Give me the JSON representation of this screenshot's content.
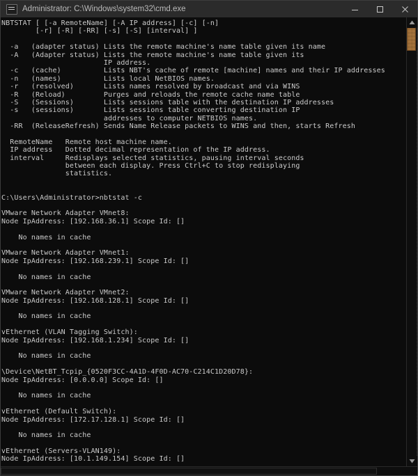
{
  "window": {
    "title": "Administrator: C:\\Windows\\system32\\cmd.exe",
    "icon": "cmd-icon",
    "minimize_label": "–",
    "maximize_label": "□",
    "close_label": "✕",
    "background_color": "#0c0c0c",
    "titlebar_color": "#2b2b2b",
    "text_color": "#cccccc",
    "scrollbar_thumb_color": "#8a5d2e"
  },
  "console": {
    "lines": [
      "NBTSTAT [ [-a RemoteName] [-A IP address] [-c] [-n]",
      "        [-r] [-R] [-RR] [-s] [-S] [interval] ]",
      "",
      "  -a   (adapter status) Lists the remote machine's name table given its name",
      "  -A   (Adapter status) Lists the remote machine's name table given its",
      "                        IP address.",
      "  -c   (cache)          Lists NBT's cache of remote [machine] names and their IP addresses",
      "  -n   (names)          Lists local NetBIOS names.",
      "  -r   (resolved)       Lists names resolved by broadcast and via WINS",
      "  -R   (Reload)         Purges and reloads the remote cache name table",
      "  -S   (Sessions)       Lists sessions table with the destination IP addresses",
      "  -s   (sessions)       Lists sessions table converting destination IP",
      "                        addresses to computer NETBIOS names.",
      "  -RR  (ReleaseRefresh) Sends Name Release packets to WINS and then, starts Refresh",
      "",
      "  RemoteName   Remote host machine name.",
      "  IP address   Dotted decimal representation of the IP address.",
      "  interval     Redisplays selected statistics, pausing interval seconds",
      "               between each display. Press Ctrl+C to stop redisplaying",
      "               statistics.",
      "",
      "",
      "C:\\Users\\Administrator>nbtstat -c",
      "",
      "VMware Network Adapter VMnet8:",
      "Node IpAddress: [192.168.36.1] Scope Id: []",
      "",
      "    No names in cache",
      "",
      "VMware Network Adapter VMnet1:",
      "Node IpAddress: [192.168.239.1] Scope Id: []",
      "",
      "    No names in cache",
      "",
      "VMware Network Adapter VMnet2:",
      "Node IpAddress: [192.168.128.1] Scope Id: []",
      "",
      "    No names in cache",
      "",
      "vEthernet (VLAN Tagging Switch):",
      "Node IpAddress: [192.168.1.234] Scope Id: []",
      "",
      "    No names in cache",
      "",
      "\\Device\\NetBT_Tcpip_{0520F3CC-4A1D-4F0D-AC70-C214C1D20D78}:",
      "Node IpAddress: [0.0.0.0] Scope Id: []",
      "",
      "    No names in cache",
      "",
      "vEthernet (Default Switch):",
      "Node IpAddress: [172.17.128.1] Scope Id: []",
      "",
      "    No names in cache",
      "",
      "vEthernet (Servers-VLAN149):",
      "Node IpAddress: [10.1.149.154] Scope Id: []"
    ],
    "prompt": "C:\\Users\\Administrator>",
    "command": "nbtstat -c"
  },
  "scrollbar": {
    "up_arrow": "scroll-up-icon",
    "down_arrow": "scroll-down-icon"
  }
}
